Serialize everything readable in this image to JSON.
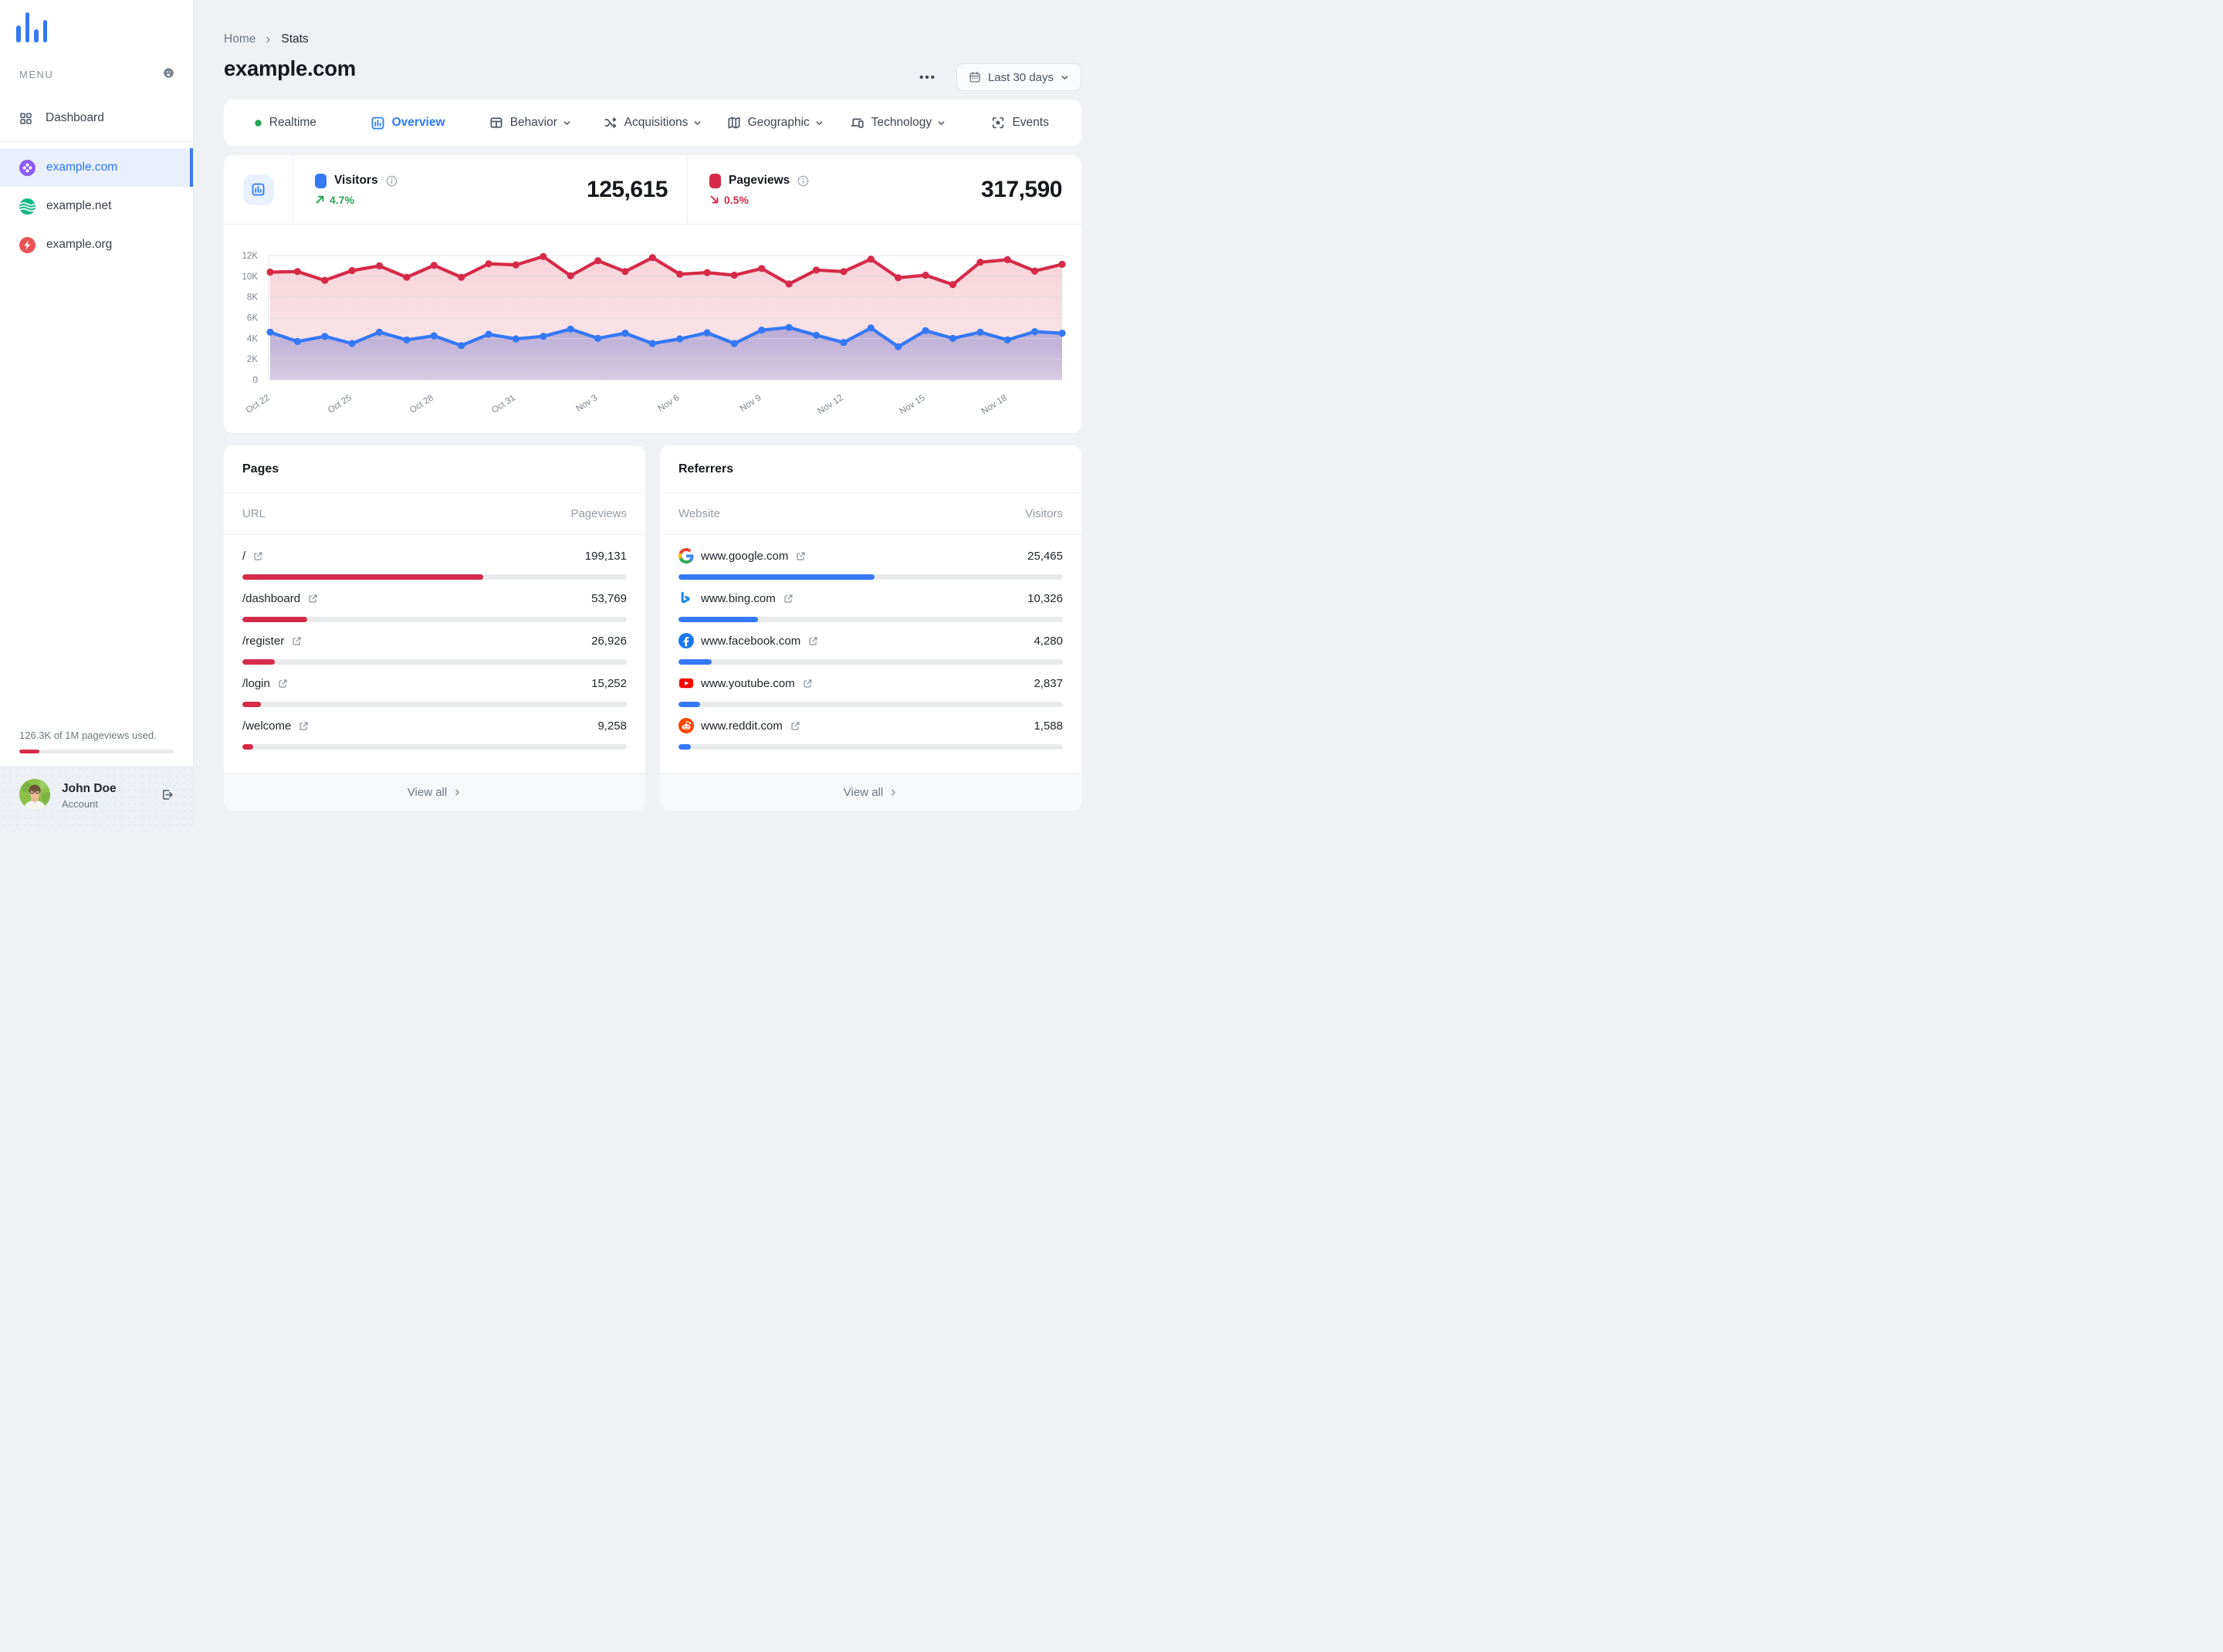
{
  "colors": {
    "accent_blue": "#3478F6",
    "red": "#D62A49",
    "green": "#27A356"
  },
  "sidebar": {
    "menu_label": "MENU",
    "dashboard_label": "Dashboard",
    "sites": [
      {
        "label": "example.com",
        "icon": "clover",
        "active": true
      },
      {
        "label": "example.net",
        "icon": "waves",
        "active": false
      },
      {
        "label": "example.org",
        "icon": "bolt",
        "active": false
      }
    ],
    "usage": {
      "text": "126.3K of 1M pageviews used.",
      "percent": 12.8
    },
    "account": {
      "name": "John Doe",
      "role": "Account"
    }
  },
  "header": {
    "breadcrumb": {
      "home": "Home",
      "current": "Stats"
    },
    "title": "example.com",
    "more_label": "•••",
    "date_range": "Last 30 days"
  },
  "tabs": [
    {
      "label": "Realtime",
      "icon": "pulse-dot"
    },
    {
      "label": "Overview",
      "icon": "bar-chart",
      "active": true
    },
    {
      "label": "Behavior",
      "icon": "browser-window",
      "dropdown": true
    },
    {
      "label": "Acquisitions",
      "icon": "split-arrows",
      "dropdown": true
    },
    {
      "label": "Geographic",
      "icon": "folded-map",
      "dropdown": true
    },
    {
      "label": "Technology",
      "icon": "devices",
      "dropdown": true
    },
    {
      "label": "Events",
      "icon": "focus-target"
    }
  ],
  "stats": {
    "visitors": {
      "label": "Visitors",
      "value": "125,615",
      "change": "4.7%",
      "direction": "up"
    },
    "pageviews": {
      "label": "Pageviews",
      "value": "317,590",
      "change": "0.5%",
      "direction": "down"
    }
  },
  "chart_data": {
    "type": "area",
    "points": 30,
    "x_tick_labels": [
      "Oct 22",
      "Oct 25",
      "Oct 28",
      "Oct 31",
      "Nov 3",
      "Nov 6",
      "Nov 9",
      "Nov 12",
      "Nov 15",
      "Nov 18"
    ],
    "label_every": 3,
    "ylim": [
      0,
      12000
    ],
    "yticks": [
      "0",
      "2K",
      "4K",
      "6K",
      "8K",
      "10K",
      "12K"
    ],
    "grid": true,
    "legend_position": "none",
    "series": [
      {
        "name": "Pageviews",
        "color": "#D62A49",
        "values": [
          10400,
          10450,
          9600,
          10550,
          11000,
          9900,
          11050,
          9900,
          11200,
          11100,
          11900,
          10050,
          11500,
          10450,
          11800,
          10200,
          10350,
          10100,
          10750,
          9250,
          10600,
          10450,
          11650,
          9850,
          10100,
          9200,
          11350,
          11600,
          10500,
          11150
        ]
      },
      {
        "name": "Visitors",
        "color": "#3478F6",
        "values": [
          4600,
          3700,
          4200,
          3500,
          4600,
          3850,
          4250,
          3300,
          4400,
          3950,
          4200,
          4900,
          4000,
          4500,
          3500,
          3950,
          4550,
          3500,
          4800,
          5050,
          4300,
          3600,
          5000,
          3200,
          4750,
          4000,
          4600,
          3850,
          4650,
          4500
        ]
      }
    ]
  },
  "pages": {
    "title": "Pages",
    "columns": {
      "left": "URL",
      "right": "Pageviews"
    },
    "rows": [
      {
        "label": "/",
        "value": "199,131",
        "bar_pct": 62.7
      },
      {
        "label": "/dashboard",
        "value": "53,769",
        "bar_pct": 16.9
      },
      {
        "label": "/register",
        "value": "26,926",
        "bar_pct": 8.5
      },
      {
        "label": "/login",
        "value": "15,252",
        "bar_pct": 4.8
      },
      {
        "label": "/welcome",
        "value": "9,258",
        "bar_pct": 2.9
      }
    ],
    "view_all": "View all"
  },
  "referrers": {
    "title": "Referrers",
    "columns": {
      "left": "Website",
      "right": "Visitors"
    },
    "rows": [
      {
        "label": "www.google.com",
        "value": "25,465",
        "bar_pct": 51.0,
        "icon": "google"
      },
      {
        "label": "www.bing.com",
        "value": "10,326",
        "bar_pct": 20.7,
        "icon": "bing"
      },
      {
        "label": "www.facebook.com",
        "value": "4,280",
        "bar_pct": 8.6,
        "icon": "facebook"
      },
      {
        "label": "www.youtube.com",
        "value": "2,837",
        "bar_pct": 5.7,
        "icon": "youtube"
      },
      {
        "label": "www.reddit.com",
        "value": "1,588",
        "bar_pct": 3.2,
        "icon": "reddit"
      }
    ],
    "view_all": "View all"
  }
}
